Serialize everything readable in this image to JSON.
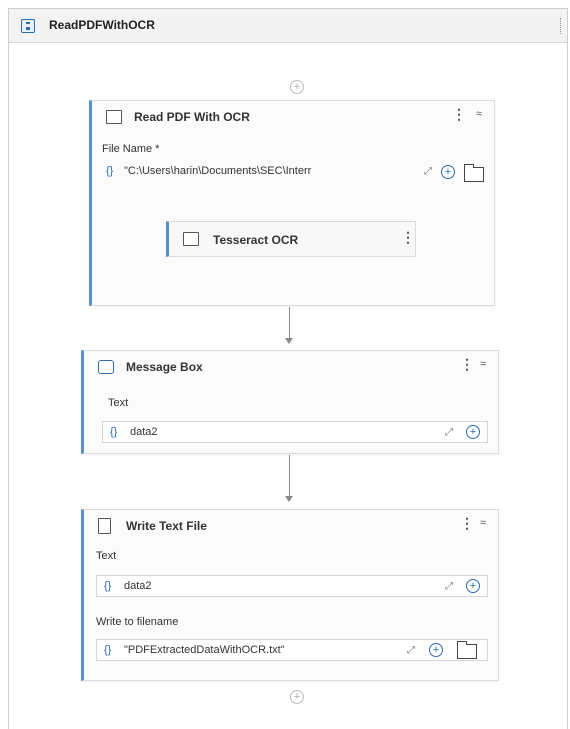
{
  "workflow": {
    "title": "ReadPDFWithOCR"
  },
  "read_pdf": {
    "title": "Read PDF With OCR",
    "file_name_label": "File Name *",
    "file_name_value": "\"C:\\Users\\harin\\Documents\\SEC\\Interr",
    "child": {
      "title": "Tesseract OCR"
    }
  },
  "message_box": {
    "title": "Message Box",
    "text_label": "Text",
    "text_value": "data2"
  },
  "write_text_file": {
    "title": "Write Text File",
    "text_label": "Text",
    "text_value": "data2",
    "filename_label": "Write to filename",
    "filename_value": "\"PDFExtractedDataWithOCR.txt\""
  },
  "glyphs": {
    "brace": "{}",
    "menu": "⋮",
    "collapse": "≈",
    "plus": "+",
    "expand": "⤢"
  },
  "colors": {
    "accent": "#5b8fc9",
    "link": "#2b6cb0"
  }
}
